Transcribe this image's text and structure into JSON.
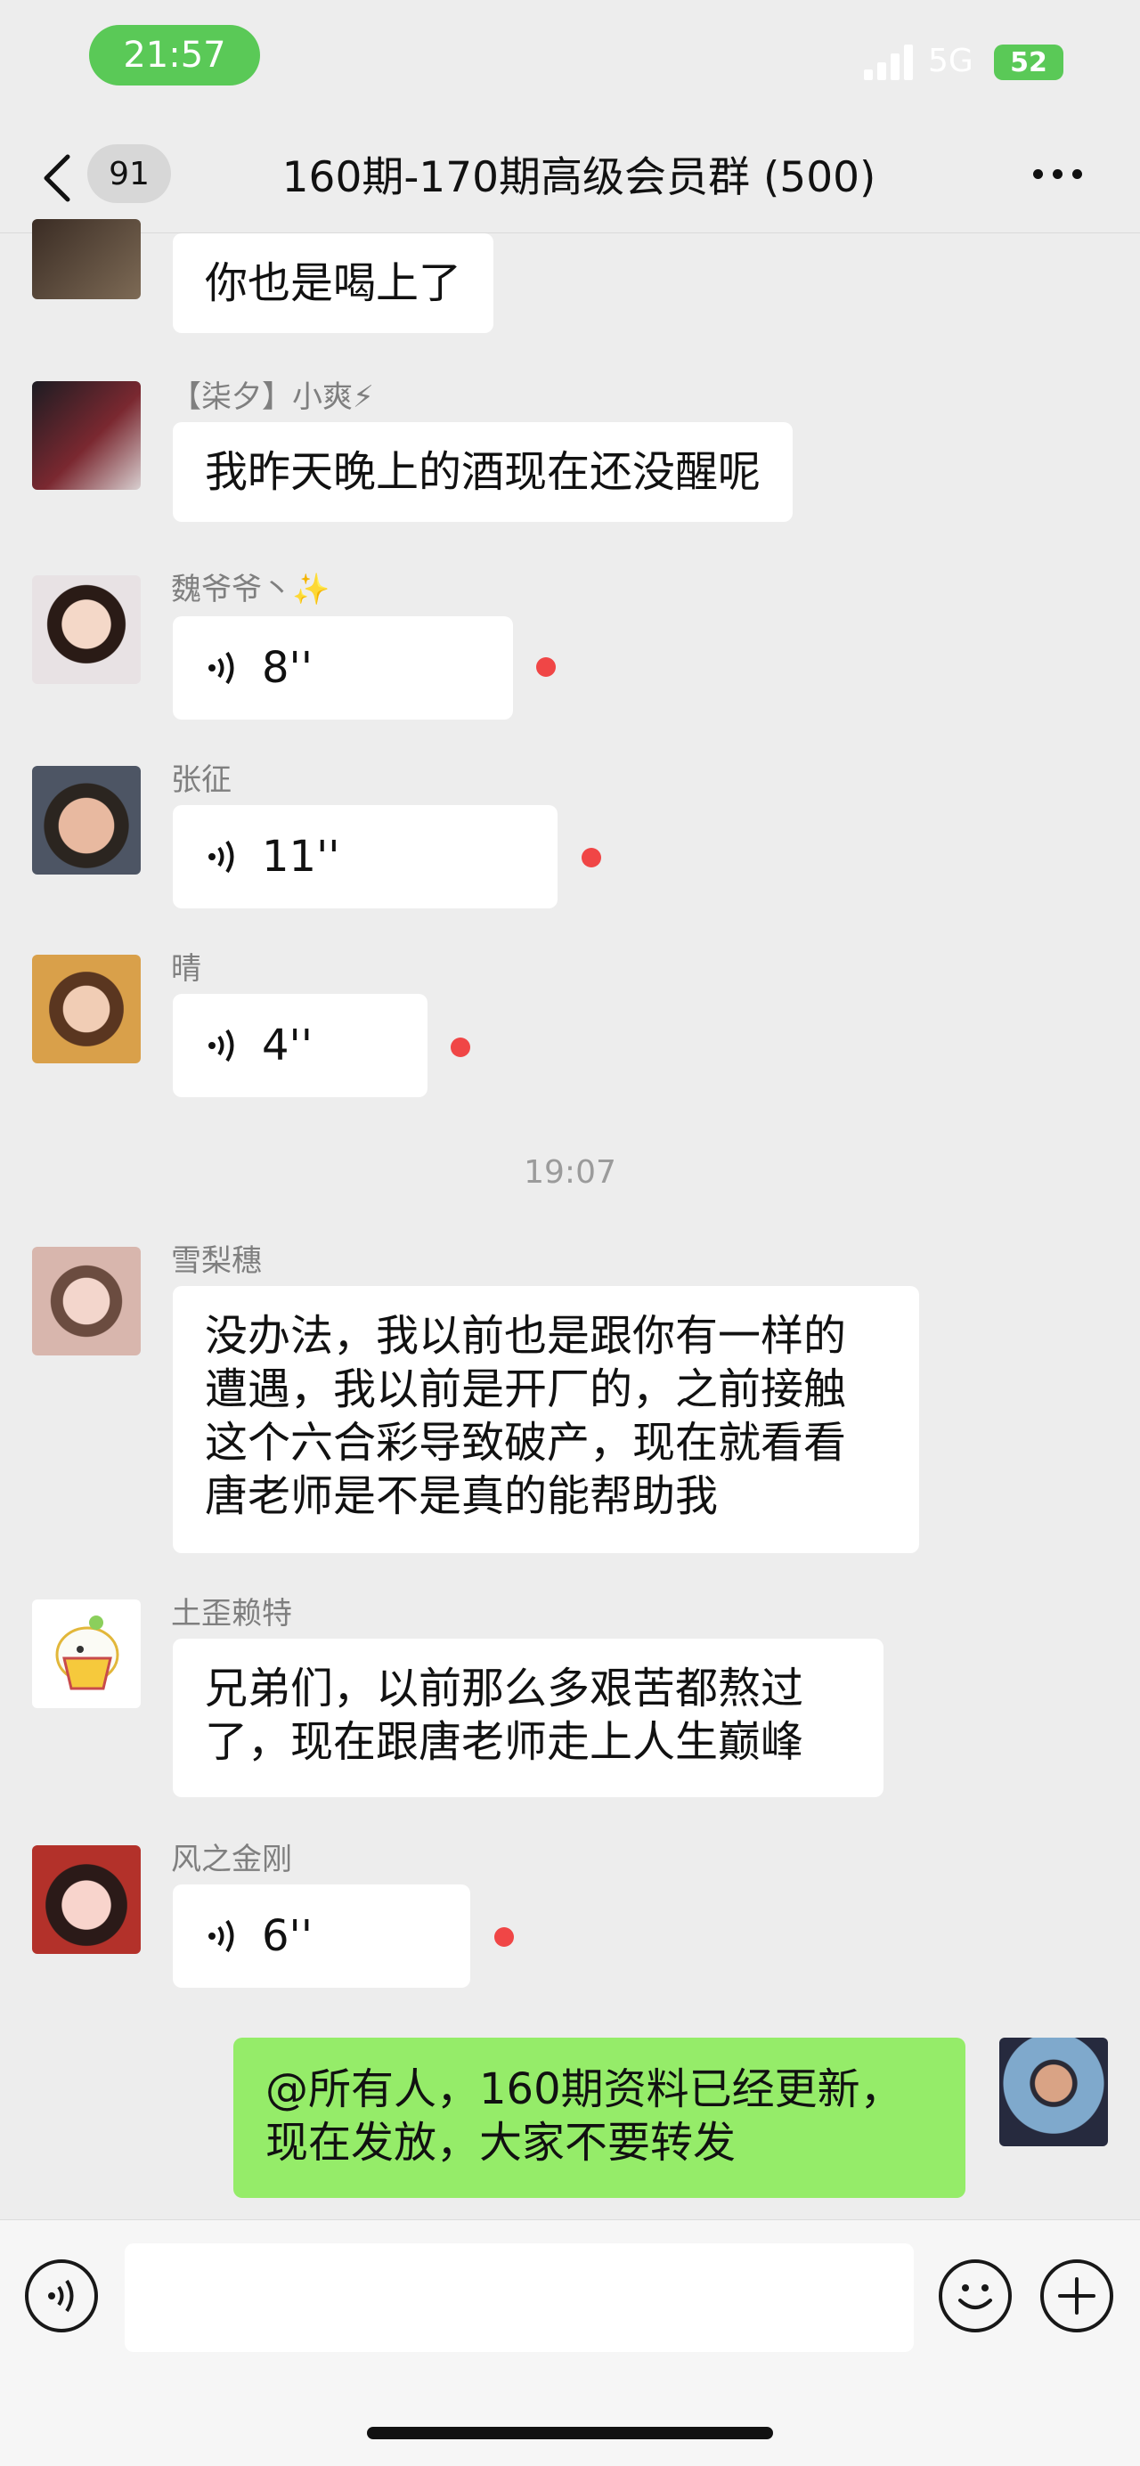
{
  "status_bar": {
    "time": "21:57",
    "network": "5G",
    "battery": "52"
  },
  "nav": {
    "unread_count": "91",
    "title": "160期-170期高级会员群 (500)"
  },
  "messages": [
    {
      "text": "你也是喝上了"
    },
    {
      "sender": "【柒夕】小爽⚡",
      "text": "我昨天晚上的酒现在还没醒呢"
    },
    {
      "sender": "魏爷爷丶✨",
      "voice": "8''"
    },
    {
      "sender": "张征",
      "voice": "11''"
    },
    {
      "sender": "晴",
      "voice": "4''"
    },
    {
      "timestamp": "19:07"
    },
    {
      "sender": "雪梨穗",
      "lines": [
        "没办法，我以前也是跟你有一样的",
        "遭遇，我以前是开厂的，之前接触",
        "这个六合彩导致破产，现在就看看",
        "唐老师是不是真的能帮助我"
      ]
    },
    {
      "sender": "土歪赖特",
      "lines": [
        "兄弟们，以前那么多艰苦都熬过",
        "了，现在跟唐老师走上人生巅峰"
      ]
    },
    {
      "sender": "风之金刚",
      "voice": "6''"
    },
    {
      "lines": [
        "@所有人，160期资料已经更新，",
        "现在发放，大家不要转发"
      ]
    }
  ],
  "colors": {
    "accent_green": "#95ec69",
    "unread_red": "#f04646",
    "status_green": "#5ac957"
  }
}
